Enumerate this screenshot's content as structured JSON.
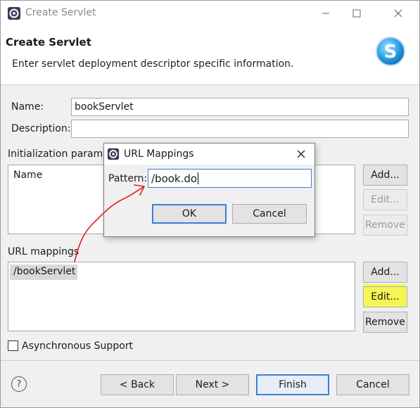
{
  "window": {
    "title": "Create Servlet",
    "controls": {
      "minimize": "—",
      "maximize": "☐",
      "close": "✕"
    }
  },
  "banner": {
    "title": "Create Servlet",
    "description": "Enter servlet deployment descriptor specific information.",
    "logo_letter": "S"
  },
  "form": {
    "name_label": "Name:",
    "name_value": "bookServlet",
    "description_label": "Description:",
    "description_value": "",
    "init_params_label": "Initialization parame",
    "init_params_header": "Name",
    "init_buttons": {
      "add": "Add...",
      "edit": "Edit...",
      "remove": "Remove"
    },
    "url_mappings_label": "URL mappings",
    "url_mappings": [
      "/bookServlet"
    ],
    "url_buttons": {
      "add": "Add...",
      "edit": "Edit...",
      "remove": "Remove"
    },
    "async_label": "Asynchronous Support",
    "async_checked": false
  },
  "footer": {
    "help": "?",
    "back": "< Back",
    "next": "Next >",
    "finish": "Finish",
    "cancel": "Cancel"
  },
  "dialog": {
    "title": "URL Mappings",
    "pattern_label": "Pattern:",
    "pattern_value": "/book.do",
    "ok": "OK",
    "cancel": "Cancel",
    "close": "✕"
  },
  "colors": {
    "highlight": "#f6f63a",
    "annotation_arrow": "#e0201b",
    "focus_blue": "#3c7fd7"
  }
}
